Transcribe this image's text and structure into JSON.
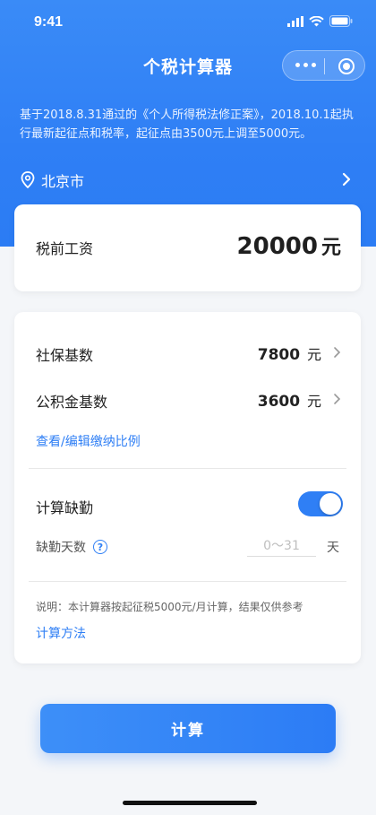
{
  "status": {
    "time": "9:41"
  },
  "nav": {
    "title": "个税计算器"
  },
  "notice": "基于2018.8.31通过的《个人所得税法修正案》，2018.10.1起执行最新起征点和税率，起征点由3500元上调至5000元。",
  "location": {
    "city": "北京市"
  },
  "salary": {
    "label": "税前工资",
    "value": "20000",
    "unit": "元"
  },
  "form": {
    "social": {
      "label": "社保基数",
      "value": "7800",
      "unit": "元"
    },
    "fund": {
      "label": "公积金基数",
      "value": "3600",
      "unit": "元"
    },
    "edit_link": "查看/编辑缴纳比例",
    "absence": {
      "label": "计算缺勤",
      "enabled": true
    },
    "absence_days": {
      "label": "缺勤天数",
      "help": "?",
      "placeholder": "0～31",
      "unit": "天"
    },
    "note": "说明：本计算器按起征税5000元/月计算，结果仅供参考",
    "method_link": "计算方法"
  },
  "button": {
    "calculate": "计算"
  },
  "colors": {
    "accent": "#2f7ff5"
  }
}
